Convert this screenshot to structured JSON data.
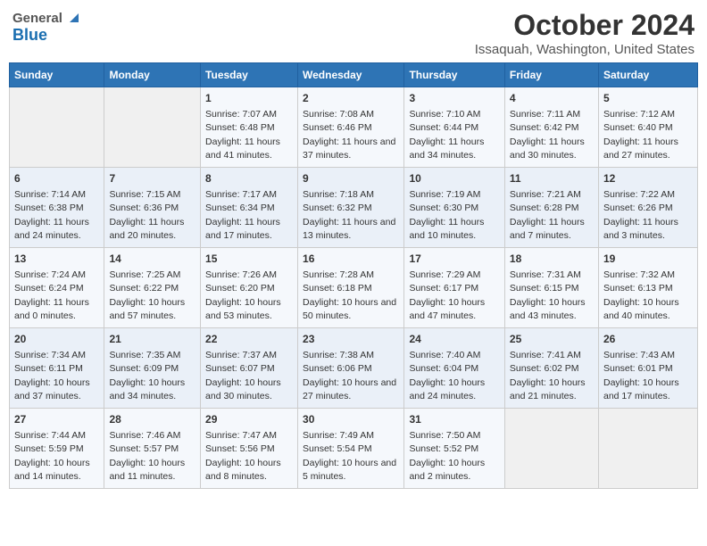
{
  "header": {
    "logo_general": "General",
    "logo_blue": "Blue",
    "title": "October 2024",
    "location": "Issaquah, Washington, United States"
  },
  "weekdays": [
    "Sunday",
    "Monday",
    "Tuesday",
    "Wednesday",
    "Thursday",
    "Friday",
    "Saturday"
  ],
  "weeks": [
    [
      {
        "day": "",
        "info": ""
      },
      {
        "day": "",
        "info": ""
      },
      {
        "day": "1",
        "info": "Sunrise: 7:07 AM\nSunset: 6:48 PM\nDaylight: 11 hours and 41 minutes."
      },
      {
        "day": "2",
        "info": "Sunrise: 7:08 AM\nSunset: 6:46 PM\nDaylight: 11 hours and 37 minutes."
      },
      {
        "day": "3",
        "info": "Sunrise: 7:10 AM\nSunset: 6:44 PM\nDaylight: 11 hours and 34 minutes."
      },
      {
        "day": "4",
        "info": "Sunrise: 7:11 AM\nSunset: 6:42 PM\nDaylight: 11 hours and 30 minutes."
      },
      {
        "day": "5",
        "info": "Sunrise: 7:12 AM\nSunset: 6:40 PM\nDaylight: 11 hours and 27 minutes."
      }
    ],
    [
      {
        "day": "6",
        "info": "Sunrise: 7:14 AM\nSunset: 6:38 PM\nDaylight: 11 hours and 24 minutes."
      },
      {
        "day": "7",
        "info": "Sunrise: 7:15 AM\nSunset: 6:36 PM\nDaylight: 11 hours and 20 minutes."
      },
      {
        "day": "8",
        "info": "Sunrise: 7:17 AM\nSunset: 6:34 PM\nDaylight: 11 hours and 17 minutes."
      },
      {
        "day": "9",
        "info": "Sunrise: 7:18 AM\nSunset: 6:32 PM\nDaylight: 11 hours and 13 minutes."
      },
      {
        "day": "10",
        "info": "Sunrise: 7:19 AM\nSunset: 6:30 PM\nDaylight: 11 hours and 10 minutes."
      },
      {
        "day": "11",
        "info": "Sunrise: 7:21 AM\nSunset: 6:28 PM\nDaylight: 11 hours and 7 minutes."
      },
      {
        "day": "12",
        "info": "Sunrise: 7:22 AM\nSunset: 6:26 PM\nDaylight: 11 hours and 3 minutes."
      }
    ],
    [
      {
        "day": "13",
        "info": "Sunrise: 7:24 AM\nSunset: 6:24 PM\nDaylight: 11 hours and 0 minutes."
      },
      {
        "day": "14",
        "info": "Sunrise: 7:25 AM\nSunset: 6:22 PM\nDaylight: 10 hours and 57 minutes."
      },
      {
        "day": "15",
        "info": "Sunrise: 7:26 AM\nSunset: 6:20 PM\nDaylight: 10 hours and 53 minutes."
      },
      {
        "day": "16",
        "info": "Sunrise: 7:28 AM\nSunset: 6:18 PM\nDaylight: 10 hours and 50 minutes."
      },
      {
        "day": "17",
        "info": "Sunrise: 7:29 AM\nSunset: 6:17 PM\nDaylight: 10 hours and 47 minutes."
      },
      {
        "day": "18",
        "info": "Sunrise: 7:31 AM\nSunset: 6:15 PM\nDaylight: 10 hours and 43 minutes."
      },
      {
        "day": "19",
        "info": "Sunrise: 7:32 AM\nSunset: 6:13 PM\nDaylight: 10 hours and 40 minutes."
      }
    ],
    [
      {
        "day": "20",
        "info": "Sunrise: 7:34 AM\nSunset: 6:11 PM\nDaylight: 10 hours and 37 minutes."
      },
      {
        "day": "21",
        "info": "Sunrise: 7:35 AM\nSunset: 6:09 PM\nDaylight: 10 hours and 34 minutes."
      },
      {
        "day": "22",
        "info": "Sunrise: 7:37 AM\nSunset: 6:07 PM\nDaylight: 10 hours and 30 minutes."
      },
      {
        "day": "23",
        "info": "Sunrise: 7:38 AM\nSunset: 6:06 PM\nDaylight: 10 hours and 27 minutes."
      },
      {
        "day": "24",
        "info": "Sunrise: 7:40 AM\nSunset: 6:04 PM\nDaylight: 10 hours and 24 minutes."
      },
      {
        "day": "25",
        "info": "Sunrise: 7:41 AM\nSunset: 6:02 PM\nDaylight: 10 hours and 21 minutes."
      },
      {
        "day": "26",
        "info": "Sunrise: 7:43 AM\nSunset: 6:01 PM\nDaylight: 10 hours and 17 minutes."
      }
    ],
    [
      {
        "day": "27",
        "info": "Sunrise: 7:44 AM\nSunset: 5:59 PM\nDaylight: 10 hours and 14 minutes."
      },
      {
        "day": "28",
        "info": "Sunrise: 7:46 AM\nSunset: 5:57 PM\nDaylight: 10 hours and 11 minutes."
      },
      {
        "day": "29",
        "info": "Sunrise: 7:47 AM\nSunset: 5:56 PM\nDaylight: 10 hours and 8 minutes."
      },
      {
        "day": "30",
        "info": "Sunrise: 7:49 AM\nSunset: 5:54 PM\nDaylight: 10 hours and 5 minutes."
      },
      {
        "day": "31",
        "info": "Sunrise: 7:50 AM\nSunset: 5:52 PM\nDaylight: 10 hours and 2 minutes."
      },
      {
        "day": "",
        "info": ""
      },
      {
        "day": "",
        "info": ""
      }
    ]
  ]
}
